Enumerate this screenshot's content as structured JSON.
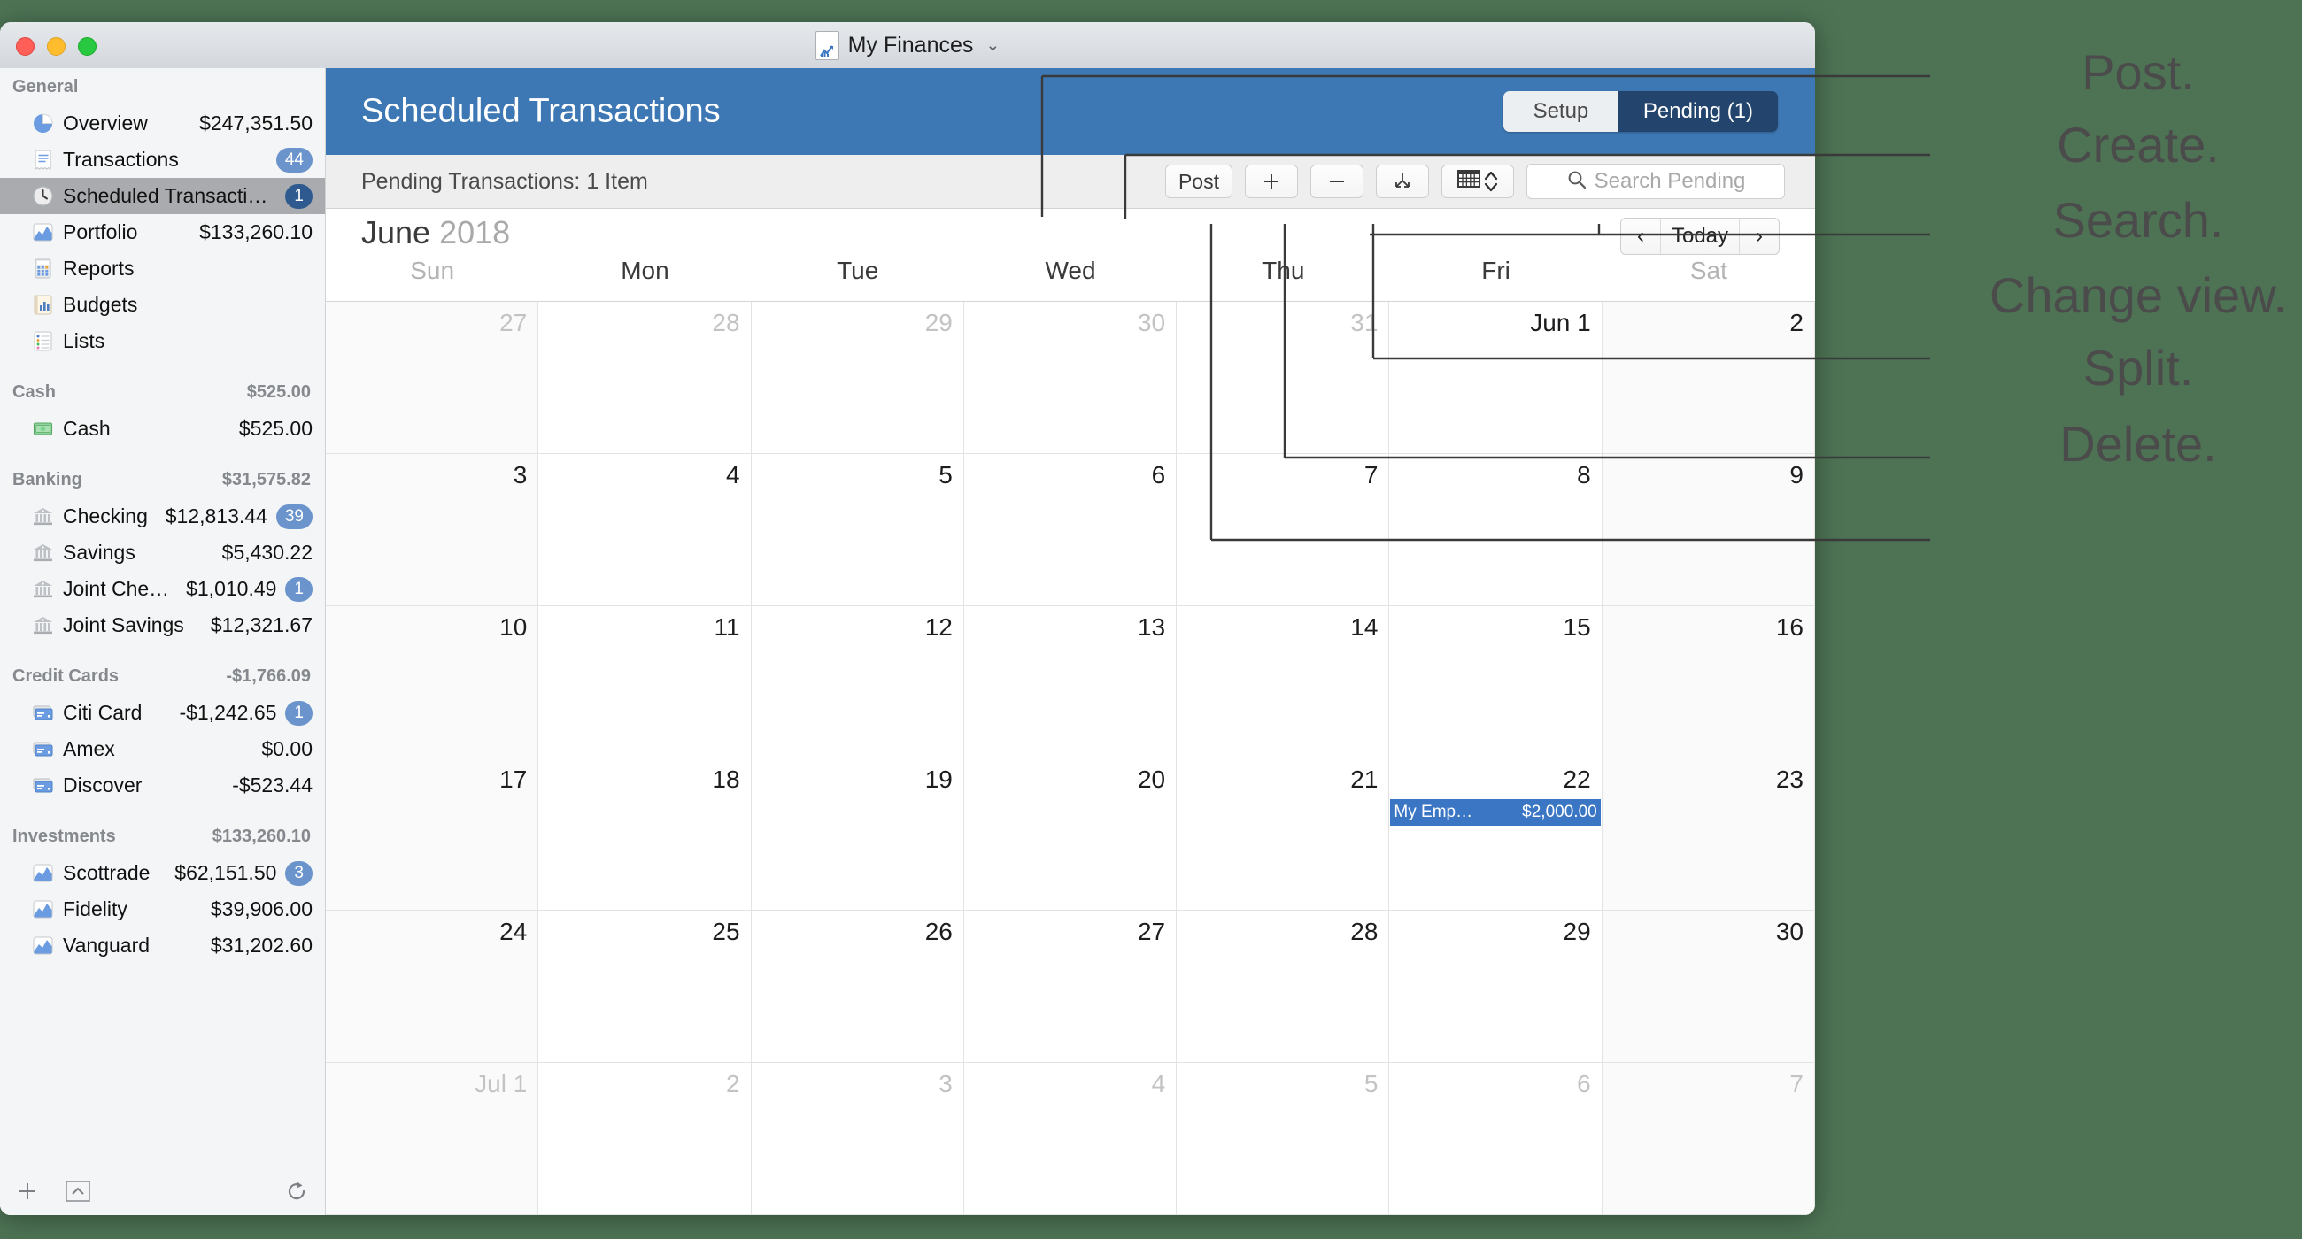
{
  "window": {
    "title": "My Finances",
    "traffic_lights": [
      "close-button",
      "minimize-button",
      "zoom-button"
    ],
    "title_chevron": "⌄"
  },
  "sidebar": {
    "sections": [
      {
        "header": "General",
        "total": "",
        "items": [
          {
            "label": "Overview",
            "amount": "$247,351.50",
            "badge": "",
            "icon": "pie-chart-icon",
            "selected": false
          },
          {
            "label": "Transactions",
            "amount": "",
            "badge": "44",
            "icon": "receipt-icon",
            "selected": false
          },
          {
            "label": "Scheduled Transactions",
            "amount": "",
            "badge": "1",
            "icon": "clock-icon",
            "selected": true
          },
          {
            "label": "Portfolio",
            "amount": "$133,260.10",
            "badge": "",
            "icon": "chart-icon",
            "selected": false
          },
          {
            "label": "Reports",
            "amount": "",
            "badge": "",
            "icon": "calculator-icon",
            "selected": false
          },
          {
            "label": "Budgets",
            "amount": "",
            "badge": "",
            "icon": "bar-chart-icon",
            "selected": false
          },
          {
            "label": "Lists",
            "amount": "",
            "badge": "",
            "icon": "list-icon",
            "selected": false
          }
        ]
      },
      {
        "header": "Cash",
        "total": "$525.00",
        "items": [
          {
            "label": "Cash",
            "amount": "$525.00",
            "badge": "",
            "icon": "money-icon",
            "selected": false
          }
        ]
      },
      {
        "header": "Banking",
        "total": "$31,575.82",
        "items": [
          {
            "label": "Checking",
            "amount": "$12,813.44",
            "badge": "39",
            "icon": "bank-icon",
            "selected": false
          },
          {
            "label": "Savings",
            "amount": "$5,430.22",
            "badge": "",
            "icon": "bank-icon",
            "selected": false
          },
          {
            "label": "Joint Check…",
            "amount": "$1,010.49",
            "badge": "1",
            "icon": "bank-icon",
            "selected": false
          },
          {
            "label": "Joint Savings",
            "amount": "$12,321.67",
            "badge": "",
            "icon": "bank-icon",
            "selected": false
          }
        ]
      },
      {
        "header": "Credit Cards",
        "total": "-$1,766.09",
        "items": [
          {
            "label": "Citi Card",
            "amount": "-$1,242.65",
            "badge": "1",
            "icon": "credit-card-icon",
            "selected": false
          },
          {
            "label": "Amex",
            "amount": "$0.00",
            "badge": "",
            "icon": "credit-card-icon",
            "selected": false
          },
          {
            "label": "Discover",
            "amount": "-$523.44",
            "badge": "",
            "icon": "credit-card-icon",
            "selected": false
          }
        ]
      },
      {
        "header": "Investments",
        "total": "$133,260.10",
        "items": [
          {
            "label": "Scottrade",
            "amount": "$62,151.50",
            "badge": "3",
            "icon": "chart-icon",
            "selected": false
          },
          {
            "label": "Fidelity",
            "amount": "$39,906.00",
            "badge": "",
            "icon": "chart-icon",
            "selected": false
          },
          {
            "label": "Vanguard",
            "amount": "$31,202.60",
            "badge": "",
            "icon": "chart-icon",
            "selected": false
          }
        ]
      }
    ],
    "footer": {
      "add": "add-account-button",
      "action": "action-menu-button",
      "refresh": "refresh-button"
    }
  },
  "header": {
    "page_title": "Scheduled Transactions",
    "segments": [
      {
        "label": "Setup",
        "active": false
      },
      {
        "label": "Pending (1)",
        "active": true
      }
    ]
  },
  "toolbar": {
    "status": "Pending Transactions: 1 Item",
    "post_label": "Post",
    "add_label": "+",
    "remove_label": "—",
    "split_label": "split-icon",
    "view_label": "calendar-icon",
    "search_placeholder": "Search Pending",
    "search_value": ""
  },
  "calendar": {
    "month": "June",
    "year": "2018",
    "nav": {
      "prev": "‹",
      "today": "Today",
      "next": "›"
    },
    "day_headers": [
      "Sun",
      "Mon",
      "Tue",
      "Wed",
      "Thu",
      "Fri",
      "Sat"
    ],
    "weeks": [
      [
        {
          "n": "27",
          "out": true
        },
        {
          "n": "28",
          "out": true
        },
        {
          "n": "29",
          "out": true
        },
        {
          "n": "30",
          "out": true
        },
        {
          "n": "31",
          "out": true
        },
        {
          "n": "Jun 1",
          "out": false
        },
        {
          "n": "2",
          "out": false
        }
      ],
      [
        {
          "n": "3",
          "out": false
        },
        {
          "n": "4",
          "out": false
        },
        {
          "n": "5",
          "out": false
        },
        {
          "n": "6",
          "out": false
        },
        {
          "n": "7",
          "out": false
        },
        {
          "n": "8",
          "out": false
        },
        {
          "n": "9",
          "out": false
        }
      ],
      [
        {
          "n": "10",
          "out": false
        },
        {
          "n": "11",
          "out": false
        },
        {
          "n": "12",
          "out": false
        },
        {
          "n": "13",
          "out": false
        },
        {
          "n": "14",
          "out": false
        },
        {
          "n": "15",
          "out": false
        },
        {
          "n": "16",
          "out": false
        }
      ],
      [
        {
          "n": "17",
          "out": false
        },
        {
          "n": "18",
          "out": false
        },
        {
          "n": "19",
          "out": false
        },
        {
          "n": "20",
          "out": false
        },
        {
          "n": "21",
          "out": false
        },
        {
          "n": "22",
          "out": false,
          "event": {
            "name": "My Emp…",
            "amount": "$2,000.00"
          }
        },
        {
          "n": "23",
          "out": false
        }
      ],
      [
        {
          "n": "24",
          "out": false
        },
        {
          "n": "25",
          "out": false
        },
        {
          "n": "26",
          "out": false
        },
        {
          "n": "27",
          "out": false
        },
        {
          "n": "28",
          "out": false
        },
        {
          "n": "29",
          "out": false
        },
        {
          "n": "30",
          "out": false
        }
      ],
      [
        {
          "n": "Jul 1",
          "out": true
        },
        {
          "n": "2",
          "out": true
        },
        {
          "n": "3",
          "out": true
        },
        {
          "n": "4",
          "out": true
        },
        {
          "n": "5",
          "out": true
        },
        {
          "n": "6",
          "out": true
        },
        {
          "n": "7",
          "out": true
        }
      ]
    ]
  },
  "annotations": [
    {
      "text": "Post."
    },
    {
      "text": "Create."
    },
    {
      "text": "Search."
    },
    {
      "text": "Change view."
    },
    {
      "text": "Split."
    },
    {
      "text": "Delete."
    }
  ],
  "colors": {
    "backdrop": "#4d7354",
    "header_blue": "#3d78b5",
    "segment_active": "#23456d",
    "badge": "#6b94cd",
    "badge_dark": "#2f5a8f",
    "event": "#3a76c4",
    "sidebar_bg": "#f4f5f6",
    "selected_row": "#a9abae"
  }
}
